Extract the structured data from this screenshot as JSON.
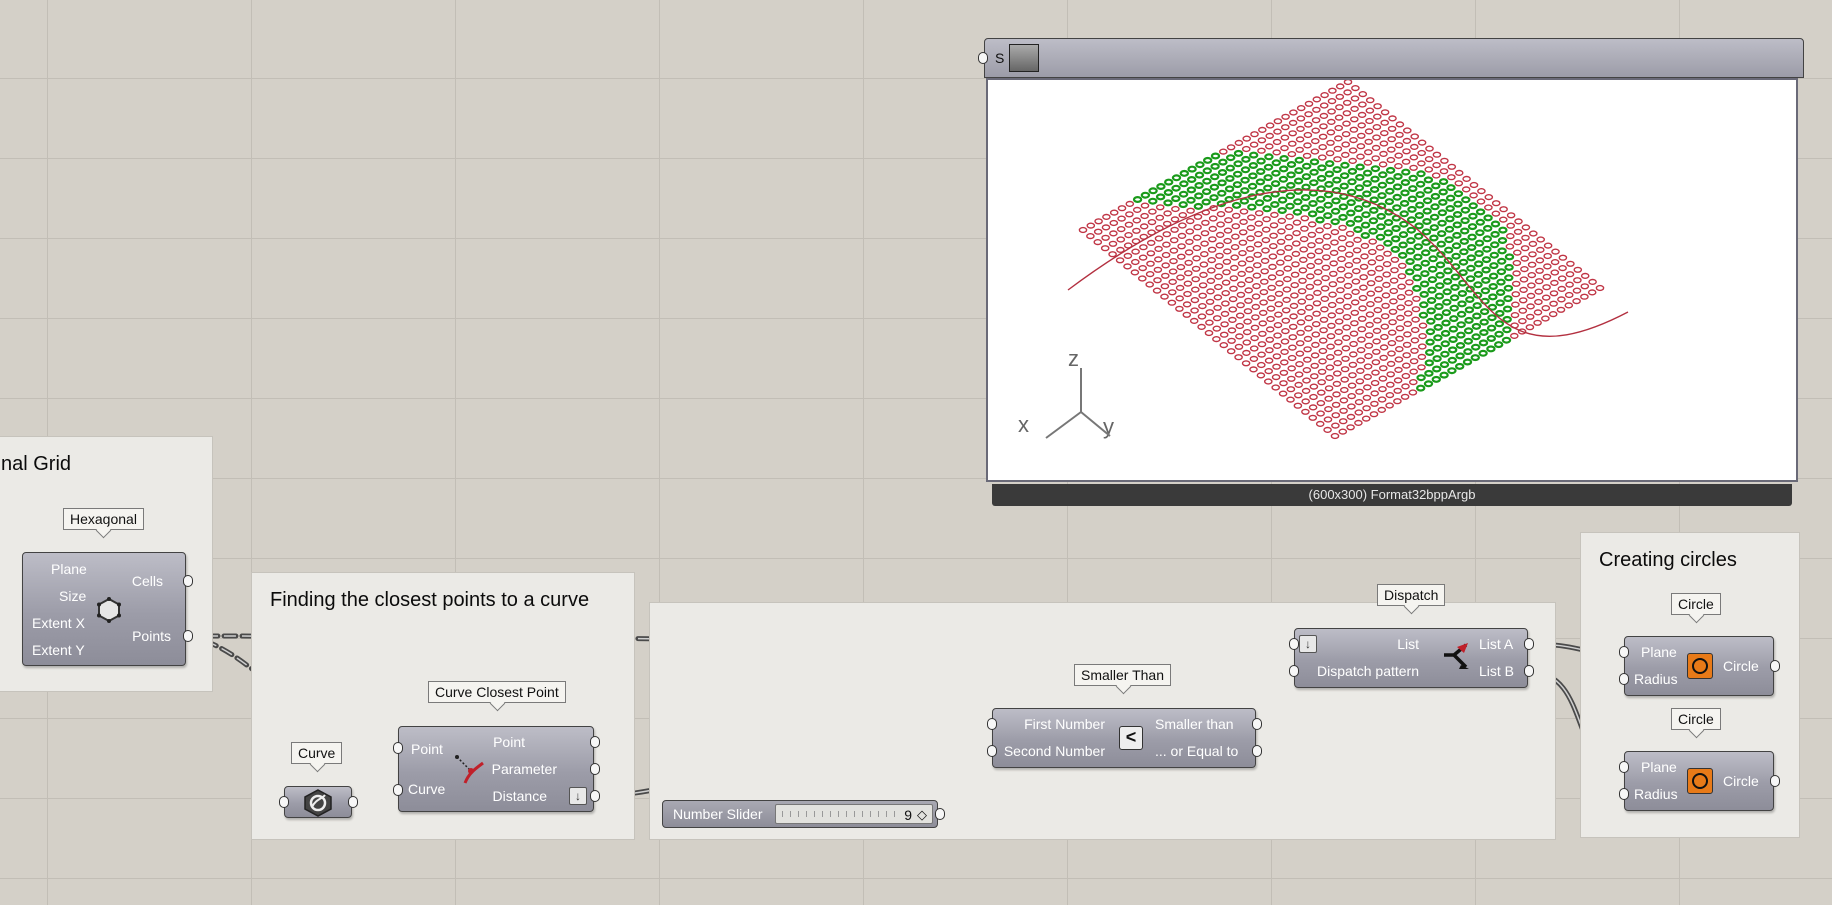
{
  "groups": {
    "hex_grid": {
      "title": "nal Grid"
    },
    "closest": {
      "title": "Finding the closest points to a curve"
    },
    "circles": {
      "title": "Creating circles"
    }
  },
  "hexagonal": {
    "nickname": "Hexagonal",
    "inputs": [
      "Plane",
      "Size",
      "Extent X",
      "Extent Y"
    ],
    "outputs": [
      "Cells",
      "Points"
    ],
    "icon": "hexagon-grid-icon"
  },
  "curve_param": {
    "nickname": "Curve",
    "icon": "curve-param-icon"
  },
  "curve_closest_point": {
    "nickname": "Curve Closest Point",
    "inputs": [
      "Point",
      "Curve"
    ],
    "outputs": [
      "Point",
      "Parameter",
      "Distance"
    ],
    "icon": "closest-point-icon"
  },
  "number_slider": {
    "label": "Number Slider",
    "value": "9"
  },
  "smaller_than": {
    "nickname": "Smaller Than",
    "inputs": [
      "First Number",
      "Second Number"
    ],
    "outputs": [
      "Smaller than",
      "... or Equal to"
    ],
    "symbol": "<"
  },
  "dispatch": {
    "nickname": "Dispatch",
    "inputs": [
      "List",
      "Dispatch pattern"
    ],
    "outputs": [
      "List A",
      "List B"
    ],
    "icon": "dispatch-icon"
  },
  "circle_a": {
    "nickname": "Circle",
    "inputs": [
      "Plane",
      "Radius"
    ],
    "outputs": [
      "Circle"
    ],
    "icon": "circle-icon"
  },
  "circle_b": {
    "nickname": "Circle",
    "inputs": [
      "Plane",
      "Radius"
    ],
    "outputs": [
      "Circle"
    ],
    "icon": "circle-icon"
  },
  "viewer": {
    "header_label": "S",
    "footer": "(600x300) Format32bppArgb",
    "axes": {
      "z": "z",
      "x": "x",
      "y": "y"
    },
    "colors": {
      "inside": "#1a9a1a",
      "outside": "#c03545"
    }
  },
  "colors": {
    "canvas": "#d4d0c8",
    "group": "#ebeae6",
    "component": "#9c9ca8",
    "wire": "#555555"
  }
}
